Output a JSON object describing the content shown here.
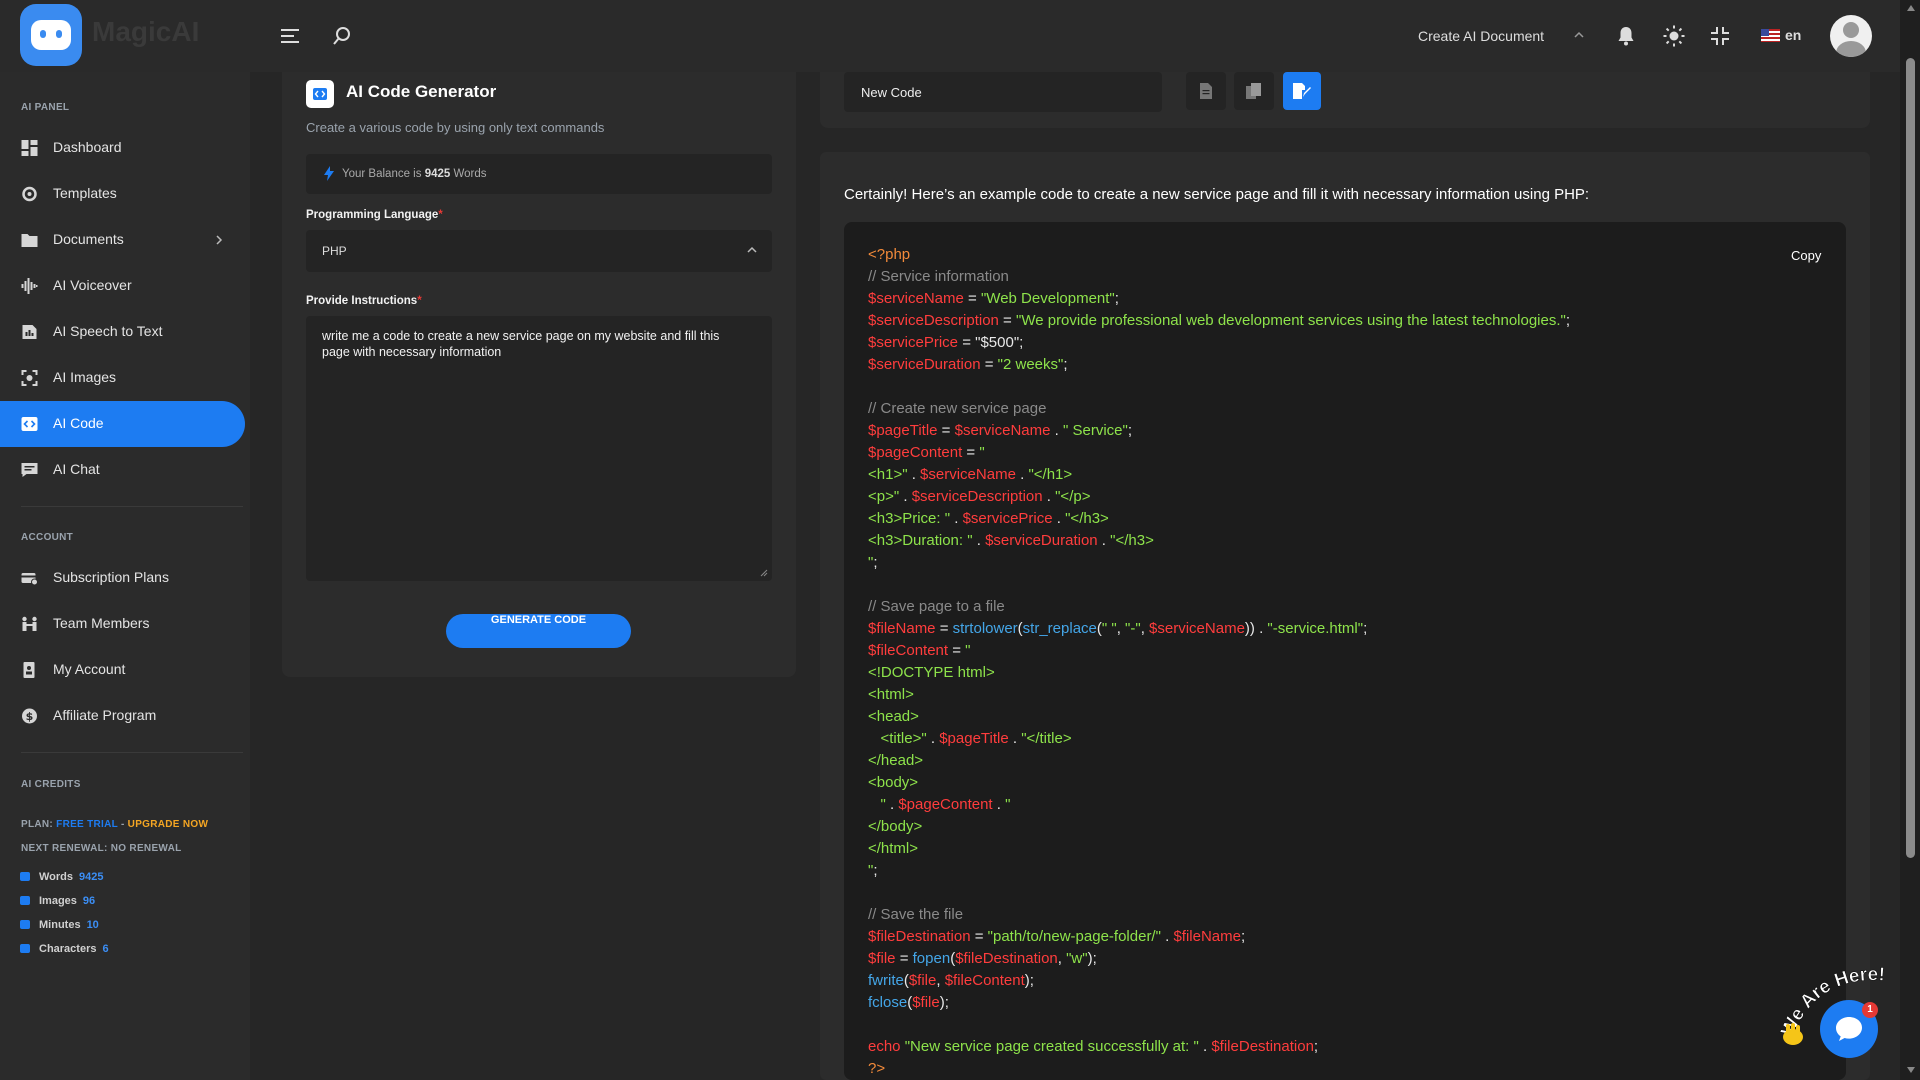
{
  "topbar": {
    "logo_text": "MagicAI",
    "create_doc": "Create AI Document",
    "language": "en"
  },
  "sidebar": {
    "ai_panel_label": "AI PANEL",
    "ai_items": [
      {
        "label": "Dashboard",
        "icon": "dashboard-icon"
      },
      {
        "label": "Templates",
        "icon": "templates-icon"
      },
      {
        "label": "Documents",
        "icon": "documents-icon"
      },
      {
        "label": "AI Voiceover",
        "icon": "voiceover-icon"
      },
      {
        "label": "AI Speech to Text",
        "icon": "speech-to-text-icon"
      },
      {
        "label": "AI Images",
        "icon": "images-icon"
      },
      {
        "label": "AI Code",
        "icon": "code-icon"
      },
      {
        "label": "AI Chat",
        "icon": "chat-icon"
      }
    ],
    "account_label": "ACCOUNT",
    "account_items": [
      {
        "label": "Subscription Plans",
        "icon": "subscription-icon"
      },
      {
        "label": "Team Members",
        "icon": "team-icon"
      },
      {
        "label": "My Account",
        "icon": "account-icon"
      },
      {
        "label": "Affiliate Program",
        "icon": "affiliate-icon"
      }
    ],
    "credits_label": "AI CREDITS",
    "plan_prefix": "PLAN:",
    "plan_name": "FREE TRIAL",
    "plan_sep": " - ",
    "upgrade": "UPGRADE NOW",
    "renewal": "NEXT RENEWAL: NO RENEWAL",
    "credits": [
      {
        "label": "Words",
        "value": "9425"
      },
      {
        "label": "Images",
        "value": "96"
      },
      {
        "label": "Minutes",
        "value": "10"
      },
      {
        "label": "Characters",
        "value": "6"
      }
    ]
  },
  "form": {
    "title": "AI Code Generator",
    "subtitle": "Create a various code by using only text commands",
    "balance_prefix": "Your Balance is ",
    "balance_value": "9425",
    "balance_suffix": " Words",
    "lang_label": "Programming Language",
    "required_mark": "*",
    "lang_value": "PHP",
    "instr_label": "Provide Instructions",
    "instr_value": "write me a code to create a new service page on my website and fill this page with necessary information",
    "generate": "GENERATE CODE"
  },
  "output": {
    "doc_name": "New Code",
    "intro": "Certainly! Here’s an example code to create a new service page and fill it with necessary information using PHP:",
    "copy": "Copy"
  },
  "code": [
    [
      [
        "co",
        "<?php"
      ]
    ],
    [
      [
        "cc",
        "// Service information"
      ]
    ],
    [
      [
        "cr",
        "$serviceName"
      ],
      [
        "cw",
        " = "
      ],
      [
        "cg",
        "\"Web Development\""
      ],
      [
        "cw",
        ";"
      ]
    ],
    [
      [
        "cr",
        "$serviceDescription"
      ],
      [
        "cw",
        " = "
      ],
      [
        "cg",
        "\"We provide professional web development services using the latest technologies.\""
      ],
      [
        "cw",
        ";"
      ]
    ],
    [
      [
        "cr",
        "$servicePrice"
      ],
      [
        "cw",
        " = "
      ],
      [
        "cw",
        "\"$500\";"
      ]
    ],
    [
      [
        "cr",
        "$serviceDuration"
      ],
      [
        "cw",
        " = "
      ],
      [
        "cg",
        "\"2 weeks\""
      ],
      [
        "cw",
        ";"
      ]
    ],
    [],
    [
      [
        "cc",
        "// Create new service page"
      ]
    ],
    [
      [
        "cr",
        "$pageTitle"
      ],
      [
        "cw",
        " = "
      ],
      [
        "cr",
        "$serviceName"
      ],
      [
        "cw",
        " . "
      ],
      [
        "cg",
        "\" Service\""
      ],
      [
        "cw",
        ";"
      ]
    ],
    [
      [
        "cr",
        "$pageContent"
      ],
      [
        "cw",
        " = "
      ],
      [
        "cg",
        "\""
      ]
    ],
    [
      [
        "cg",
        "<h1>\""
      ],
      [
        "cw",
        " . "
      ],
      [
        "cr",
        "$serviceName"
      ],
      [
        "cw",
        " . "
      ],
      [
        "cg",
        "\"</h1>"
      ]
    ],
    [
      [
        "cg",
        "<p>\""
      ],
      [
        "cw",
        " . "
      ],
      [
        "cr",
        "$serviceDescription"
      ],
      [
        "cw",
        " . "
      ],
      [
        "cg",
        "\"</p>"
      ]
    ],
    [
      [
        "cg",
        "<h3>Price: \""
      ],
      [
        "cw",
        " . "
      ],
      [
        "cr",
        "$servicePrice"
      ],
      [
        "cw",
        " . "
      ],
      [
        "cg",
        "\"</h3>"
      ]
    ],
    [
      [
        "cg",
        "<h3>Duration: \""
      ],
      [
        "cw",
        " . "
      ],
      [
        "cr",
        "$serviceDuration"
      ],
      [
        "cw",
        " . "
      ],
      [
        "cg",
        "\"</h3>"
      ]
    ],
    [
      [
        "cg",
        "\""
      ],
      [
        "cw",
        ";"
      ]
    ],
    [],
    [
      [
        "cc",
        "// Save page to a file"
      ]
    ],
    [
      [
        "cr",
        "$fileName"
      ],
      [
        "cw",
        " = "
      ],
      [
        "cb",
        "strtolower"
      ],
      [
        "cw",
        "("
      ],
      [
        "cb",
        "str_replace"
      ],
      [
        "cw",
        "("
      ],
      [
        "cg",
        "\" \""
      ],
      [
        "cw",
        ", "
      ],
      [
        "cg",
        "\"-\""
      ],
      [
        "cw",
        ", "
      ],
      [
        "cr",
        "$serviceName"
      ],
      [
        "cw",
        ")) . "
      ],
      [
        "cg",
        "\"-service.html\""
      ],
      [
        "cw",
        ";"
      ]
    ],
    [
      [
        "cr",
        "$fileContent"
      ],
      [
        "cw",
        " = "
      ],
      [
        "cg",
        "\""
      ]
    ],
    [
      [
        "cg",
        "<!DOCTYPE html>"
      ]
    ],
    [
      [
        "cg",
        "<html>"
      ]
    ],
    [
      [
        "cg",
        "<head>"
      ]
    ],
    [
      [
        "cg",
        "   <title>\""
      ],
      [
        "cw",
        " . "
      ],
      [
        "cr",
        "$pageTitle"
      ],
      [
        "cw",
        " . "
      ],
      [
        "cg",
        "\"</title>"
      ]
    ],
    [
      [
        "cg",
        "</head>"
      ]
    ],
    [
      [
        "cg",
        "<body>"
      ]
    ],
    [
      [
        "cg",
        "   \""
      ],
      [
        "cw",
        " . "
      ],
      [
        "cr",
        "$pageContent"
      ],
      [
        "cw",
        " . "
      ],
      [
        "cg",
        "\""
      ]
    ],
    [
      [
        "cg",
        "</body>"
      ]
    ],
    [
      [
        "cg",
        "</html>"
      ]
    ],
    [
      [
        "cg",
        "\""
      ],
      [
        "cw",
        ";"
      ]
    ],
    [],
    [
      [
        "cc",
        "// Save the file"
      ]
    ],
    [
      [
        "cr",
        "$fileDestination"
      ],
      [
        "cw",
        " = "
      ],
      [
        "cg",
        "\"path/to/new-page-folder/\""
      ],
      [
        "cw",
        " . "
      ],
      [
        "cr",
        "$fileName"
      ],
      [
        "cw",
        ";"
      ]
    ],
    [
      [
        "cr",
        "$file"
      ],
      [
        "cw",
        " = "
      ],
      [
        "cb",
        "fopen"
      ],
      [
        "cw",
        "("
      ],
      [
        "cr",
        "$fileDestination"
      ],
      [
        "cw",
        ", "
      ],
      [
        "cg",
        "\"w\""
      ],
      [
        "cw",
        ");"
      ]
    ],
    [
      [
        "cb",
        "fwrite"
      ],
      [
        "cw",
        "("
      ],
      [
        "cr",
        "$file"
      ],
      [
        "cw",
        ", "
      ],
      [
        "cr",
        "$fileContent"
      ],
      [
        "cw",
        ");"
      ]
    ],
    [
      [
        "cb",
        "fclose"
      ],
      [
        "cw",
        "("
      ],
      [
        "cr",
        "$file"
      ],
      [
        "cw",
        ");"
      ]
    ],
    [],
    [
      [
        "cr",
        "echo"
      ],
      [
        "cw",
        " "
      ],
      [
        "cg",
        "\"New service page created successfully at: \""
      ],
      [
        "cw",
        " . "
      ],
      [
        "cr",
        "$fileDestination"
      ],
      [
        "cw",
        ";"
      ]
    ],
    [
      [
        "co",
        "?>"
      ]
    ]
  ],
  "chat_widget": {
    "bubble_text": "We Are Here!",
    "badge": "1"
  },
  "colors": {
    "accent": "#1d7cf2",
    "plan_name": "#1d7cf2",
    "upgrade": "#f5a623"
  }
}
